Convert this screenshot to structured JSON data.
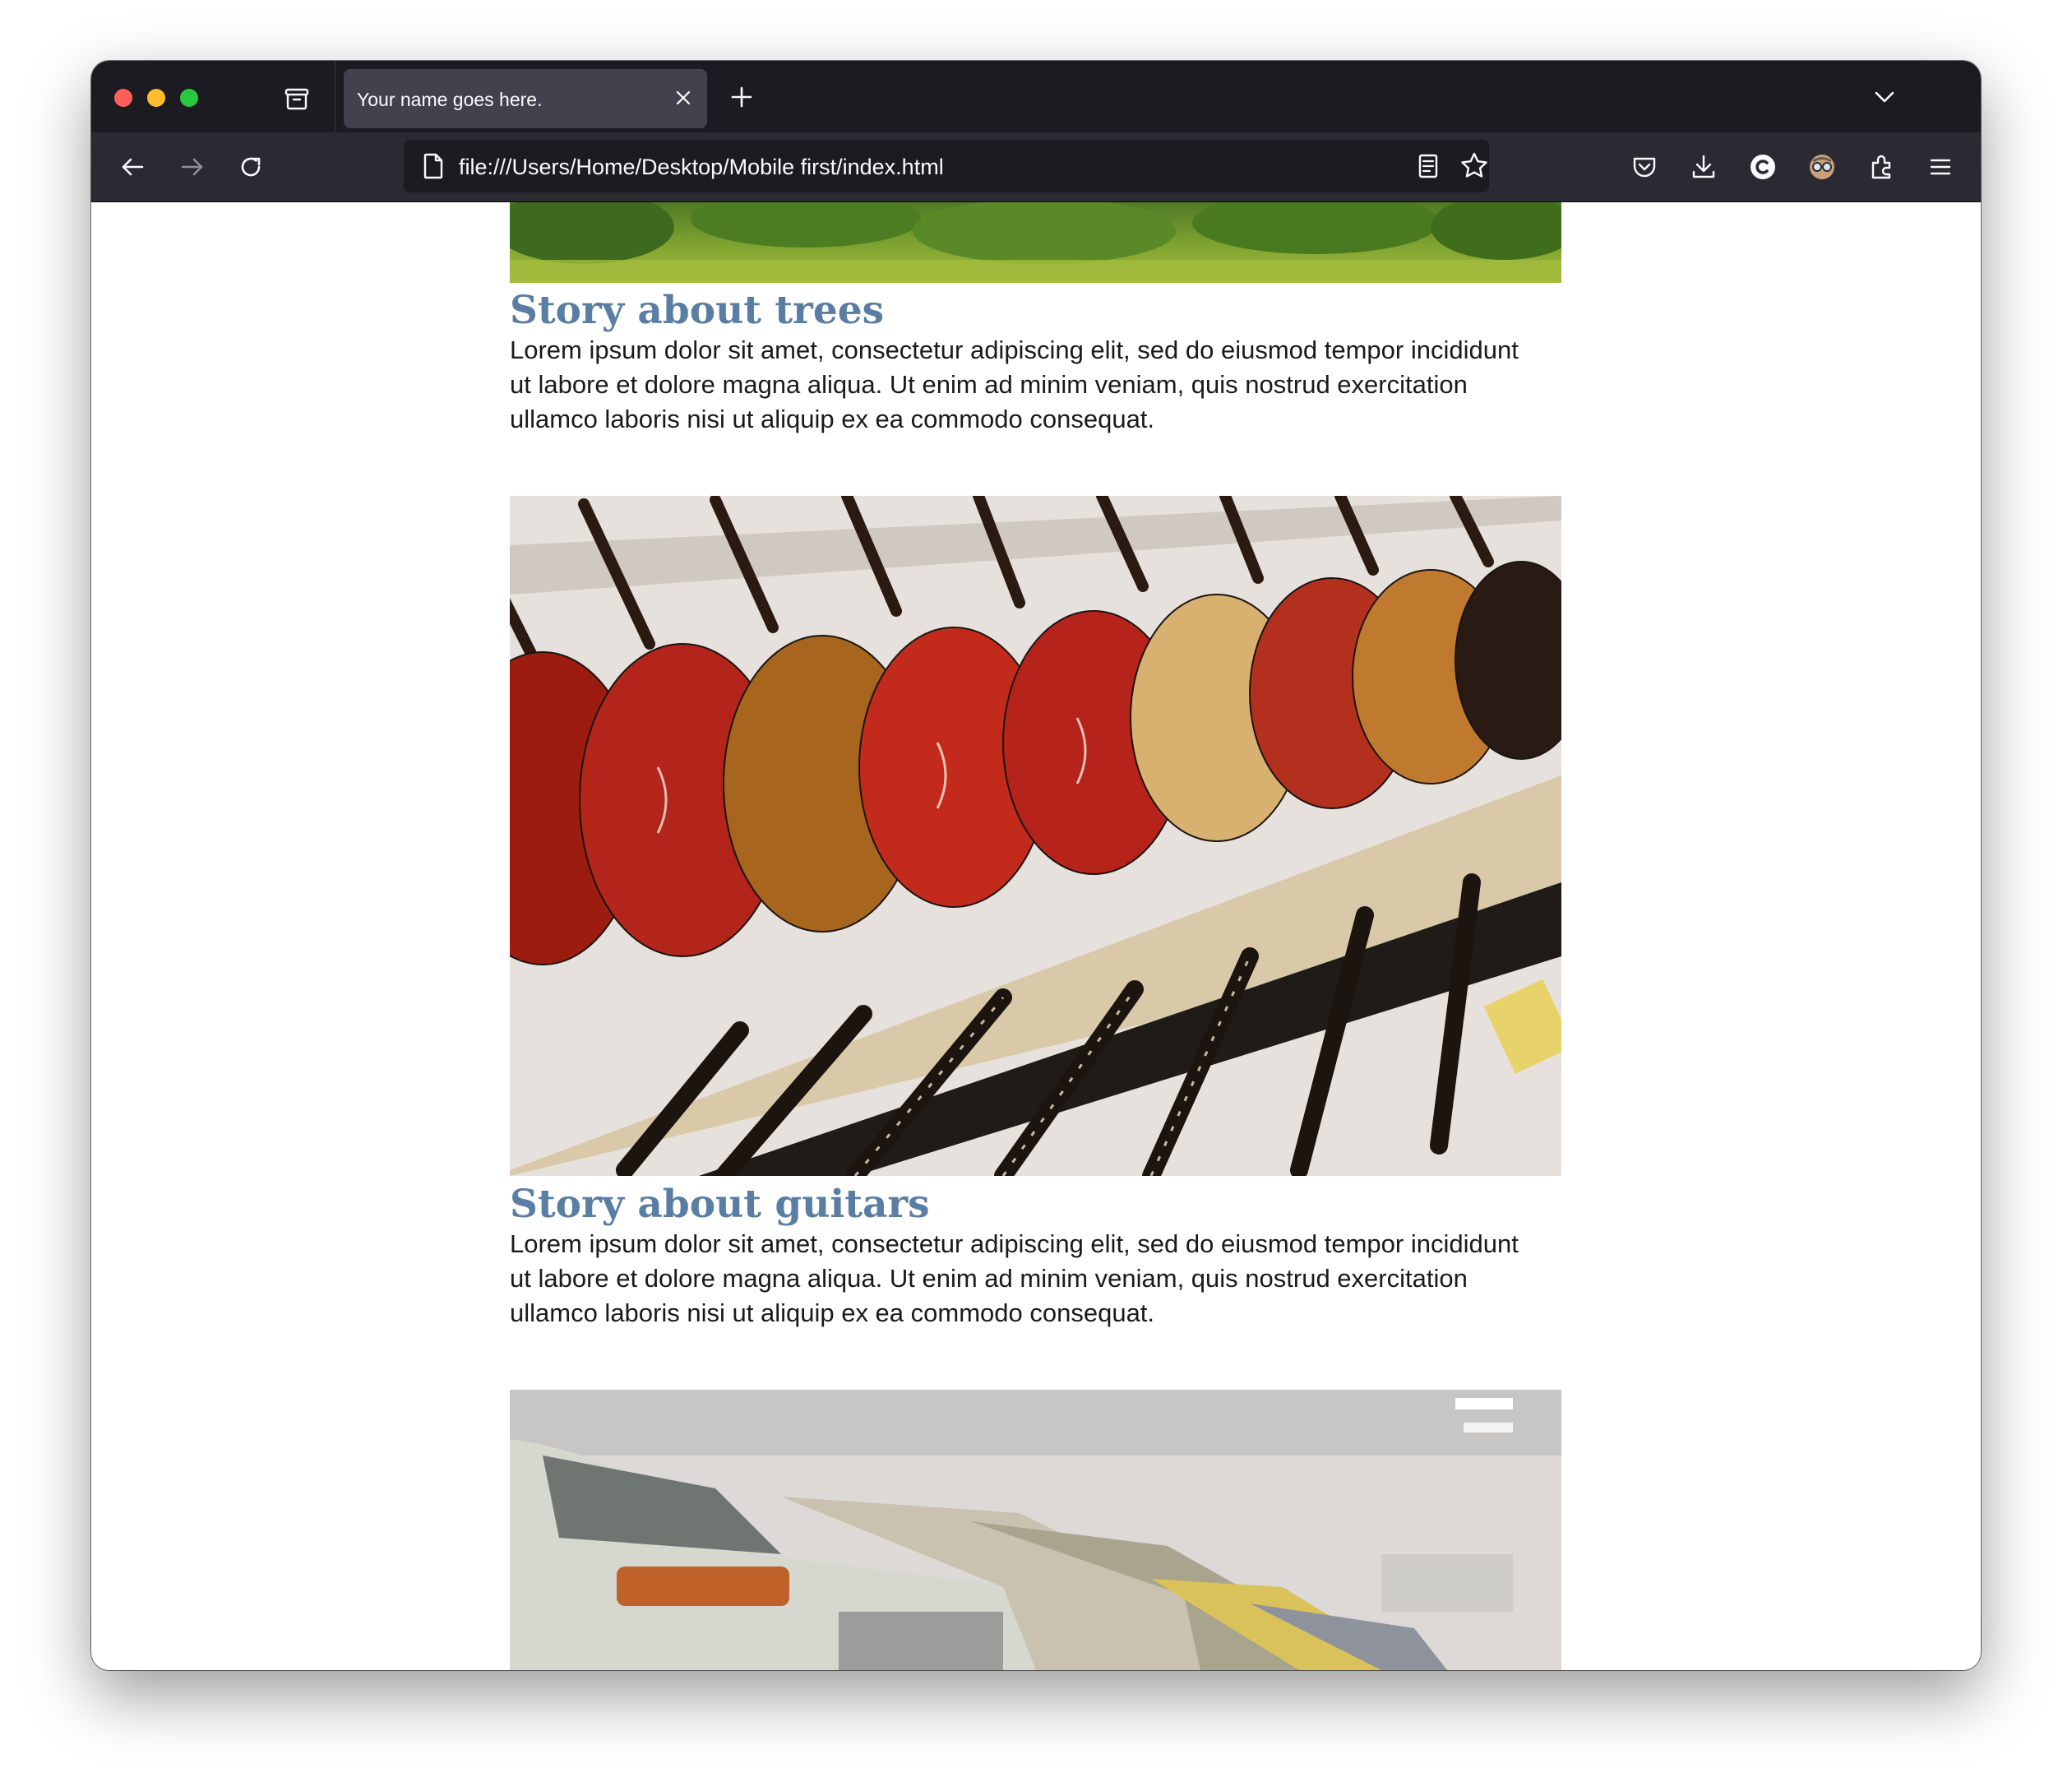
{
  "browser": {
    "tab_title": "Your name goes here.",
    "url": "file:///Users/Home/Desktop/Mobile first/index.html"
  },
  "stories": [
    {
      "title": "Story about trees",
      "text": "Lorem ipsum dolor sit amet, consectetur adipiscing elit, sed do eiusmod tempor incididunt ut labore et dolore magna aliqua. Ut enim ad minim veniam, quis nostrud exercitation ullamco laboris nisi ut aliquip ex ea commodo consequat."
    },
    {
      "title": "Story about guitars",
      "text": "Lorem ipsum dolor sit amet, consectetur adipiscing elit, sed do eiusmod tempor incididunt ut labore et dolore magna aliqua. Ut enim ad minim veniam, quis nostrud exercitation ullamco laboris nisi ut aliquip ex ea commodo consequat."
    }
  ],
  "colors": {
    "tab_strip": "#1c1b22",
    "toolbar": "#2b2a33",
    "active_tab": "#42414d",
    "story_title": "#5a7da3"
  }
}
